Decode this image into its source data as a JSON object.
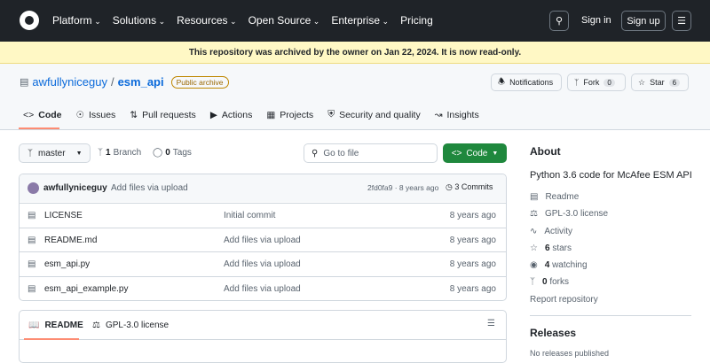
{
  "header": {
    "nav": [
      "Platform",
      "Solutions",
      "Resources",
      "Open Source",
      "Enterprise",
      "Pricing"
    ],
    "sign_in": "Sign in",
    "sign_up": "Sign up"
  },
  "banner": "This repository was archived by the owner on Jan 22, 2024. It is now read-only.",
  "repo": {
    "owner": "awfullyniceguy",
    "name": "esm_api",
    "badge": "Public archive",
    "notifications": "Notifications",
    "fork": "Fork",
    "fork_count": "0",
    "star": "Star",
    "star_count": "6"
  },
  "tabs": [
    "Code",
    "Issues",
    "Pull requests",
    "Actions",
    "Projects",
    "Security and quality",
    "Insights"
  ],
  "toolbar": {
    "branch": "master",
    "branches_n": "1",
    "branches": "Branch",
    "tags_n": "0",
    "tags": "Tags",
    "search_placeholder": "Go to file",
    "code": "Code"
  },
  "commit": {
    "author": "awfullyniceguy",
    "message": "Add files via upload",
    "hash": "2fd0fa9 · 8 years ago",
    "commits": "3 Commits"
  },
  "files": [
    {
      "name": "LICENSE",
      "msg": "Initial commit",
      "age": "8 years ago"
    },
    {
      "name": "README.md",
      "msg": "Add files via upload",
      "age": "8 years ago"
    },
    {
      "name": "esm_api.py",
      "msg": "Add files via upload",
      "age": "8 years ago"
    },
    {
      "name": "esm_api_example.py",
      "msg": "Add files via upload",
      "age": "8 years ago"
    }
  ],
  "readme": {
    "tab1": "README",
    "tab2": "GPL-3.0 license"
  },
  "about": {
    "title": "About",
    "desc": "Python 3.6 code for McAfee ESM API",
    "readme": "Readme",
    "license": "GPL-3.0 license",
    "activity": "Activity",
    "stars_n": "6",
    "stars": "stars",
    "watching_n": "4",
    "watching": "watching",
    "forks_n": "0",
    "forks": "forks",
    "report": "Report repository"
  },
  "releases": {
    "title": "Releases",
    "empty": "No releases published"
  }
}
